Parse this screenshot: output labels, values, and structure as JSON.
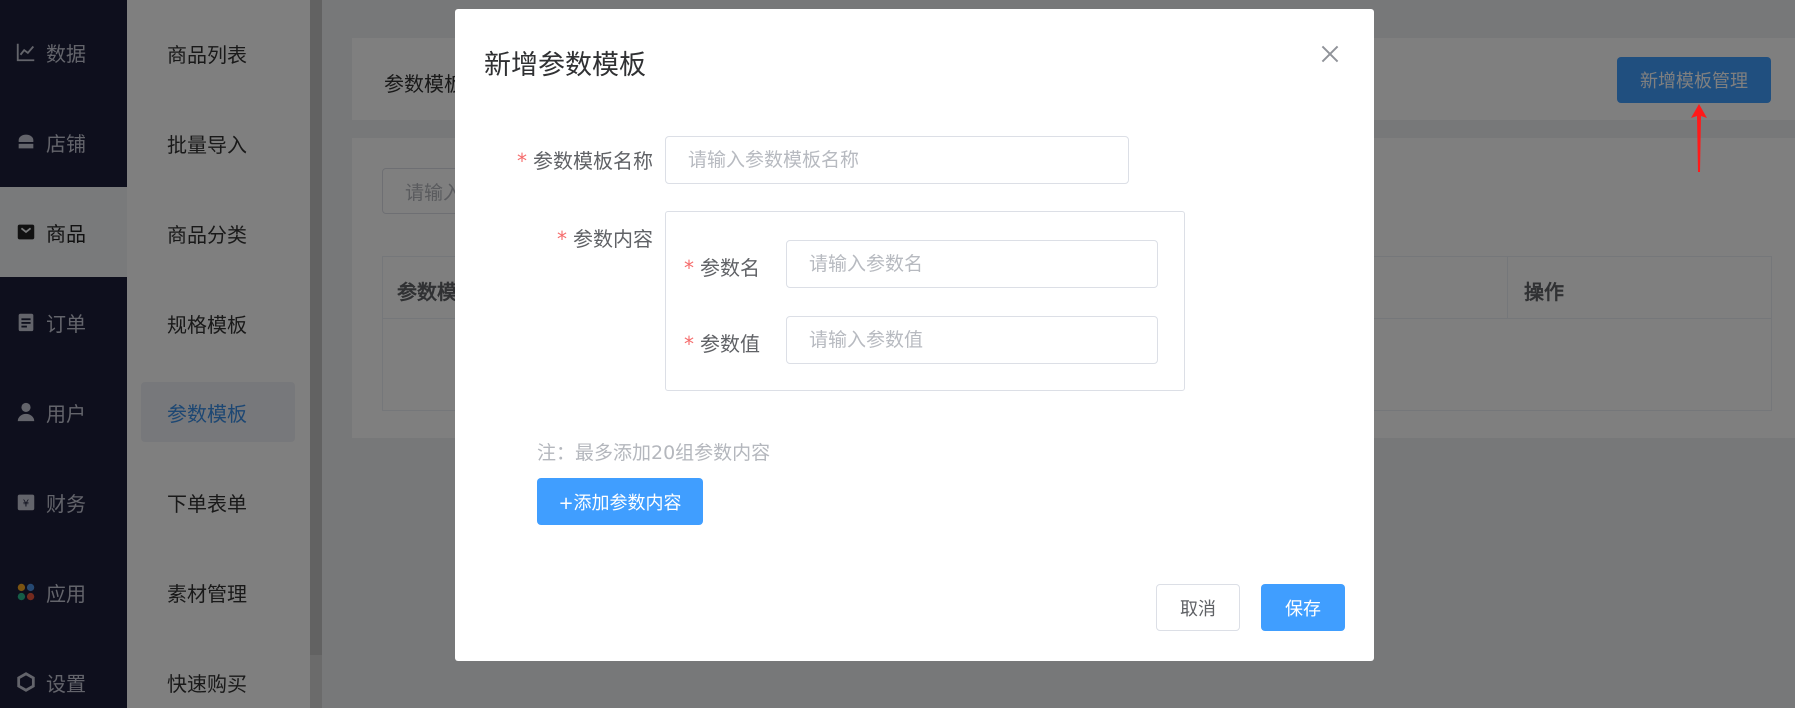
{
  "primary_nav": {
    "items": [
      {
        "label": "数据",
        "icon": "chart-line-icon"
      },
      {
        "label": "店铺",
        "icon": "shop-icon"
      },
      {
        "label": "商品",
        "icon": "goods-icon",
        "active": true
      },
      {
        "label": "订单",
        "icon": "clipboard-icon"
      },
      {
        "label": "用户",
        "icon": "user-icon"
      },
      {
        "label": "财务",
        "icon": "finance-icon"
      },
      {
        "label": "应用",
        "icon": "apps-icon"
      },
      {
        "label": "设置",
        "icon": "settings-icon"
      }
    ]
  },
  "secondary_nav": {
    "items": [
      {
        "label": "商品列表"
      },
      {
        "label": "批量导入"
      },
      {
        "label": "商品分类"
      },
      {
        "label": "规格模板"
      },
      {
        "label": "参数模板",
        "active": true
      },
      {
        "label": "下单表单"
      },
      {
        "label": "素材管理"
      },
      {
        "label": "快速购买"
      }
    ]
  },
  "page": {
    "crumb": "参数模板",
    "add_manage_button": "新增模板管理",
    "search_placeholder": "请输入",
    "table_headers": [
      "参数模",
      "操作"
    ]
  },
  "dialog": {
    "title": "新增参数模板",
    "template_name_label": "参数模板名称",
    "template_name_placeholder": "请输入参数模板名称",
    "param_content_label": "参数内容",
    "param_name_label": "参数名",
    "param_name_placeholder": "请输入参数名",
    "param_value_label": "参数值",
    "param_value_placeholder": "请输入参数值",
    "note": "注：最多添加20组参数内容",
    "add_button": "+添加参数内容",
    "cancel_button": "取消",
    "save_button": "保存",
    "required_mark": "*"
  },
  "colors": {
    "primary": "#409eff",
    "sidebar_dark": "#1d1e3a",
    "required": "#f56c6c",
    "annotation_arrow": "#ff1a1a"
  }
}
